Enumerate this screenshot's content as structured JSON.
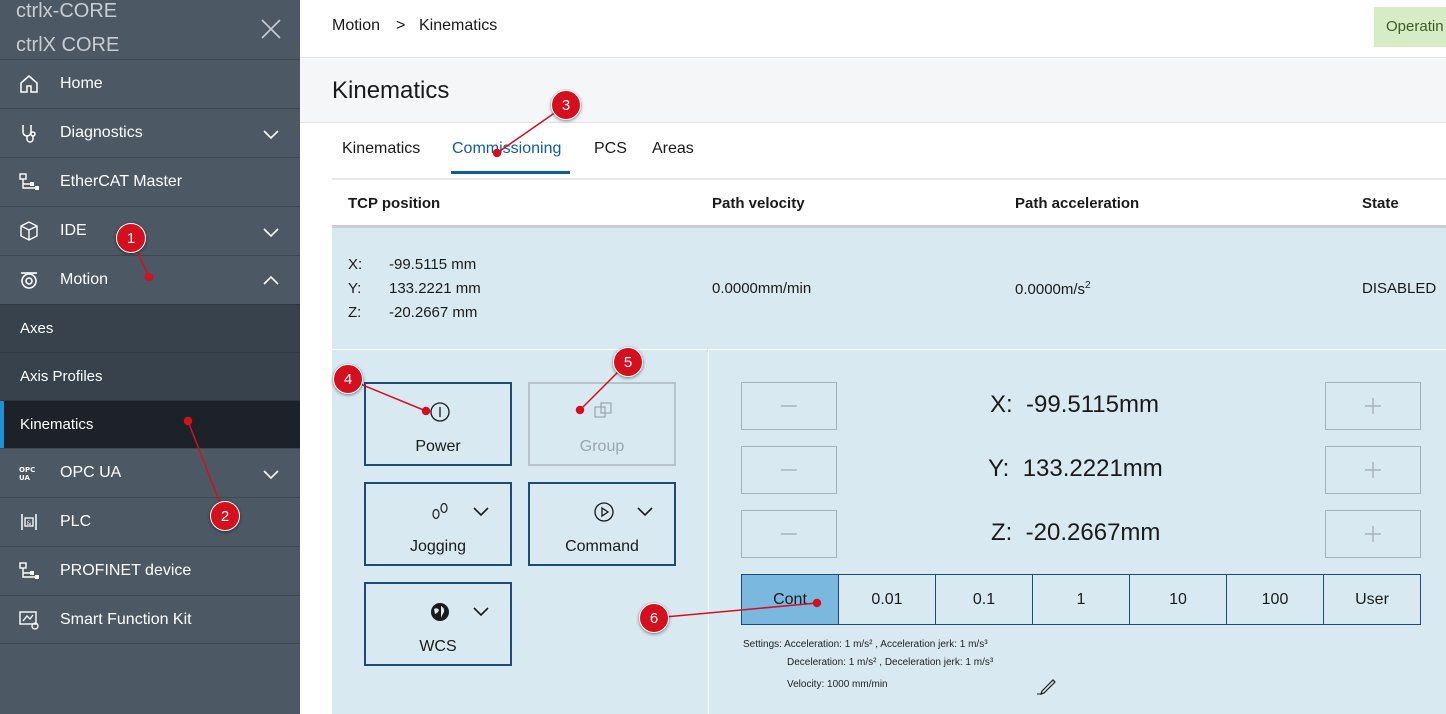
{
  "sidebar": {
    "brand_line1": "ctrlx-CORE",
    "brand_line2": "ctrlX CORE",
    "items": [
      {
        "label": "Home",
        "icon": "home-icon"
      },
      {
        "label": "Diagnostics",
        "icon": "stethoscope-icon"
      },
      {
        "label": "EtherCAT Master",
        "icon": "network-icon"
      },
      {
        "label": "IDE",
        "icon": "package-icon"
      },
      {
        "label": "Motion",
        "icon": "motion-icon"
      },
      {
        "label": "OPC UA",
        "icon": "opcua-icon"
      },
      {
        "label": "PLC",
        "icon": "plc-icon"
      },
      {
        "label": "PROFINET device",
        "icon": "network-icon"
      },
      {
        "label": "Smart Function Kit",
        "icon": "smart-kit-icon"
      }
    ],
    "motion_sub": [
      "Axes",
      "Axis Profiles",
      "Kinematics"
    ]
  },
  "breadcrumb": {
    "parent": "Motion",
    "separator": ">",
    "current": "Kinematics"
  },
  "operating_state": "Operatin",
  "page_title": "Kinematics",
  "tabs": [
    "Kinematics",
    "Commissioning",
    "PCS",
    "Areas"
  ],
  "table": {
    "headers": [
      "TCP position",
      "Path velocity",
      "Path acceleration",
      "State"
    ],
    "tcp": [
      {
        "axis": "X:",
        "value": "-99.5115 mm"
      },
      {
        "axis": "Y:",
        "value": "133.2221 mm"
      },
      {
        "axis": "Z:",
        "value": "-20.2667 mm"
      }
    ],
    "velocity": "0.0000mm/min",
    "acceleration": "0.0000m/s",
    "acceleration_sup": "2",
    "state": "DISABLED"
  },
  "controls": {
    "power": "Power",
    "group": "Group",
    "jogging": "Jogging",
    "command": "Command",
    "wcs": "WCS"
  },
  "jog": {
    "minus": "—",
    "plus": "+",
    "coords": [
      {
        "axis": "X:",
        "value": "-99.5115mm"
      },
      {
        "axis": "Y:",
        "value": "133.2221mm"
      },
      {
        "axis": "Z:",
        "value": "-20.2667mm"
      }
    ],
    "steps": [
      "Cont",
      "0.01",
      "0.1",
      "1",
      "10",
      "100",
      "User"
    ],
    "active_step": "Cont"
  },
  "settings": {
    "line1": "Settings: Acceleration: 1 m/s² , Acceleration jerk: 1 m/s³",
    "line2": "Deceleration: 1 m/s² , Deceleration jerk: 1 m/s³",
    "line3": "Velocity: 1000 mm/min"
  },
  "annotations": [
    "1",
    "2",
    "3",
    "4",
    "5",
    "6"
  ],
  "colors": {
    "sidebar": "#4c5864",
    "active_blue": "#0f5e9c",
    "annotation_red": "#d4101e",
    "panel": "#d9e9f2"
  }
}
